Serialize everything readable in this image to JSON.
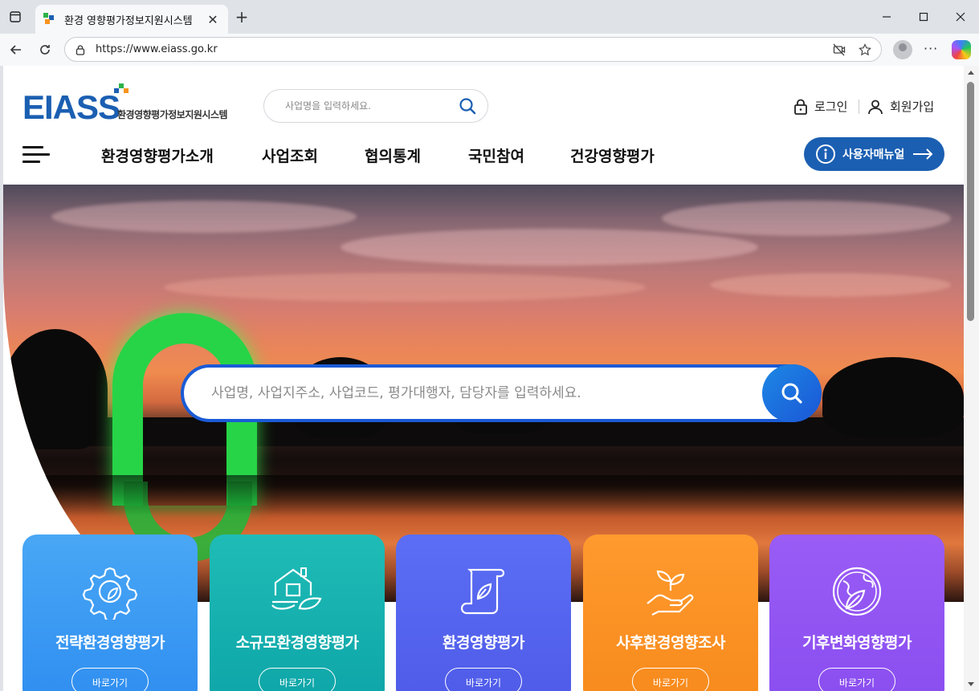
{
  "browser": {
    "tab_title": "환경 영향평가정보지원시스템",
    "url": "https://www.eiass.go.kr"
  },
  "header": {
    "logo_text": "EIASS",
    "logo_subtitle": "환경영향평가정보지원시스템",
    "search_placeholder": "사업명을 입력하세요.",
    "login_label": "로그인",
    "signup_label": "회원가입"
  },
  "nav": {
    "items": [
      "환경영향평가소개",
      "사업조회",
      "협의통계",
      "국민참여",
      "건강영향평가"
    ],
    "manual_label": "사용자매뉴얼"
  },
  "hero": {
    "search_placeholder": "사업명, 사업지주소, 사업코드, 평가대행자, 담당자를 입력하세요."
  },
  "cards": [
    {
      "title": "전략환경영향평가",
      "button": "바로가기",
      "color_from": "#49a7f5",
      "color_to": "#2f8ef0",
      "icon": "gear-leaf-icon"
    },
    {
      "title": "소규모환경영향평가",
      "button": "바로가기",
      "color_from": "#1fbcb6",
      "color_to": "#0ea5a8",
      "icon": "house-leaf-icon"
    },
    {
      "title": "환경영향평가",
      "button": "바로가기",
      "color_from": "#5b6ef5",
      "color_to": "#4f5be8",
      "icon": "scroll-leaf-icon"
    },
    {
      "title": "사후환경영향조사",
      "button": "바로가기",
      "color_from": "#ff9a2e",
      "color_to": "#f78a1c",
      "icon": "hand-sprout-icon"
    },
    {
      "title": "기후변화영향평가",
      "button": "바로가기",
      "color_from": "#9a5cf5",
      "color_to": "#8a4ef0",
      "icon": "globe-leaf-icon"
    }
  ],
  "colors": {
    "brand": "#1b5fb2",
    "search_border": "#1a5bd6"
  }
}
